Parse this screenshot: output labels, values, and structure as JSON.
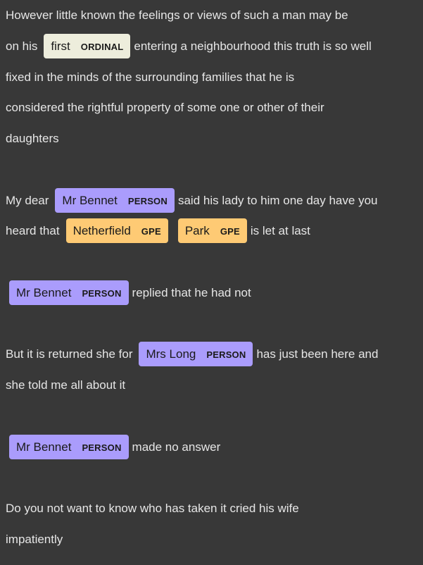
{
  "colors": {
    "background": "#383838",
    "text": "#e6e6e6",
    "ORDINAL": "#ededdc",
    "PERSON": "#aa9cfc",
    "GPE": "#feca74"
  },
  "lines": [
    {
      "segments": [
        {
          "t": "text",
          "v": "However little known the feelings or views of such a man may be"
        }
      ]
    },
    {
      "segments": [
        {
          "t": "text",
          "v": "on his"
        },
        {
          "t": "ent",
          "v": "first",
          "label": "ORDINAL"
        },
        {
          "t": "text",
          "v": "entering a neighbourhood this truth is so well"
        }
      ]
    },
    {
      "segments": [
        {
          "t": "text",
          "v": "fixed in the minds of the surrounding families that he is"
        }
      ]
    },
    {
      "segments": [
        {
          "t": "text",
          "v": "considered the rightful property of some one or other of their"
        }
      ]
    },
    {
      "segments": [
        {
          "t": "text",
          "v": "daughters"
        }
      ]
    },
    {
      "segments": [
        {
          "t": "text",
          "v": "My dear"
        },
        {
          "t": "ent",
          "v": "Mr Bennet",
          "label": "PERSON"
        },
        {
          "t": "text",
          "v": "said his lady to him one day have you"
        }
      ]
    },
    {
      "segments": [
        {
          "t": "text",
          "v": "heard that"
        },
        {
          "t": "ent",
          "v": "Netherfield",
          "label": "GPE"
        },
        {
          "t": "ent",
          "v": "Park",
          "label": "GPE"
        },
        {
          "t": "text",
          "v": "is let at last"
        }
      ]
    },
    {
      "segments": [
        {
          "t": "ent",
          "v": "Mr Bennet",
          "label": "PERSON"
        },
        {
          "t": "text",
          "v": "replied that he had not"
        }
      ]
    },
    {
      "segments": [
        {
          "t": "text",
          "v": "But it is returned she for"
        },
        {
          "t": "ent",
          "v": "Mrs Long",
          "label": "PERSON"
        },
        {
          "t": "text",
          "v": "has just been here and"
        }
      ]
    },
    {
      "segments": [
        {
          "t": "text",
          "v": "she told me all about it"
        }
      ]
    },
    {
      "segments": [
        {
          "t": "ent",
          "v": "Mr Bennet",
          "label": "PERSON"
        },
        {
          "t": "text",
          "v": "made no answer"
        }
      ]
    },
    {
      "segments": [
        {
          "t": "text",
          "v": "Do you not want to know who has taken it cried his wife"
        }
      ]
    },
    {
      "segments": [
        {
          "t": "text",
          "v": "impatiently"
        }
      ]
    }
  ]
}
